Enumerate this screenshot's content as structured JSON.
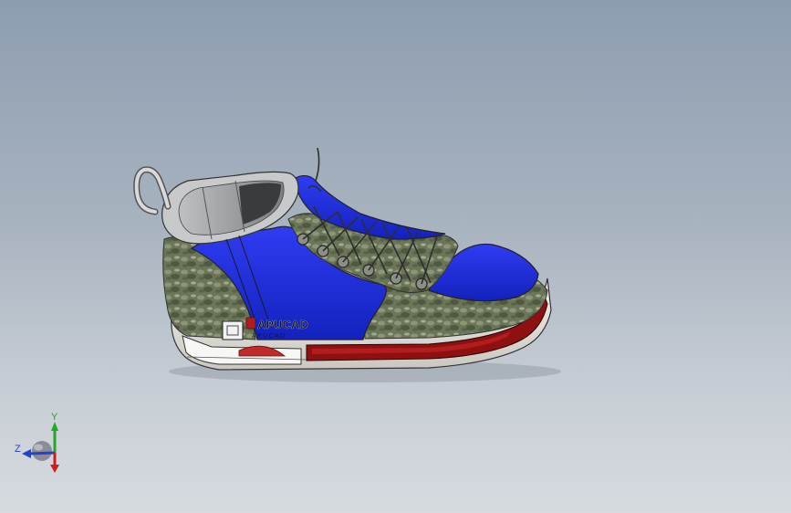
{
  "viewport": {
    "background_top": "#8d9db0",
    "background_bottom": "#d7dbe0"
  },
  "model": {
    "brand_logo": "APUCAD",
    "brand_tagline": "APUCAD",
    "colors": {
      "upper_blue": "#1f2fe0",
      "texture_green": "#6b7658",
      "sole_red": "#8e1010",
      "sole_white": "#f2f2ee",
      "lace": "#3a3a3a"
    }
  },
  "triad": {
    "x_label": "",
    "y_label": "Y",
    "z_label": "Z",
    "x_color": "#d21a1a",
    "y_color": "#22a822",
    "z_color": "#2244cc"
  }
}
